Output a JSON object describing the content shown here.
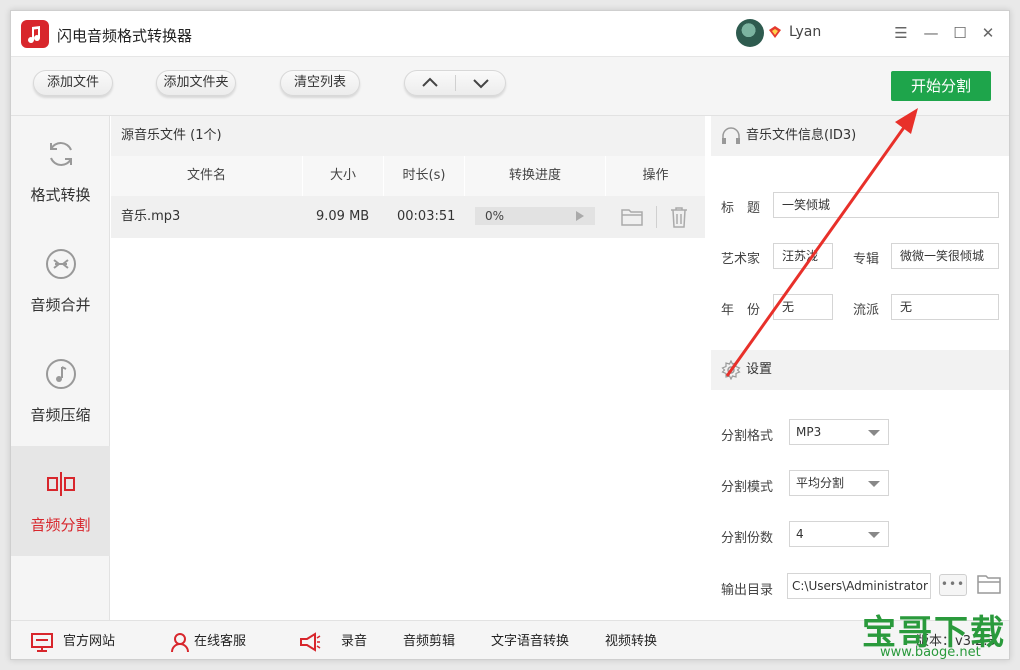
{
  "app": {
    "title": "闪电音频格式转换器",
    "username": "Lyan"
  },
  "window_controls": {
    "menu": "☰",
    "minimize": "—",
    "maximize": "☐",
    "close": "✕"
  },
  "toolbar": {
    "add_file": "添加文件",
    "add_folder": "添加文件夹",
    "clear_list": "清空列表",
    "move_up": "︿",
    "move_down": "﹀",
    "start": "开始分割"
  },
  "nav": {
    "items": [
      {
        "label": "格式转换",
        "icon": "refresh-icon"
      },
      {
        "label": "音频合并",
        "icon": "merge-icon"
      },
      {
        "label": "音频压缩",
        "icon": "music-note-icon"
      },
      {
        "label": "音频分割",
        "icon": "split-icon",
        "active": true
      }
    ]
  },
  "files": {
    "header": "源音乐文件 (1个)",
    "columns": [
      "文件名",
      "大小",
      "时长(s)",
      "转换进度",
      "操作"
    ],
    "rows": [
      {
        "name": "音乐.mp3",
        "size": "9.09 MB",
        "duration": "00:03:51",
        "progress_text": "0%",
        "progress": 0
      }
    ]
  },
  "info": {
    "header": "音乐文件信息(ID3)",
    "title_label": "标　题",
    "title_value": "一笑倾城",
    "artist_label": "艺术家",
    "artist_value": "汪苏泷",
    "album_label": "专辑",
    "album_value": "微微一笑很倾城",
    "year_label": "年　份",
    "year_value": "无",
    "genre_label": "流派",
    "genre_value": "无"
  },
  "settings": {
    "header": "设置",
    "format_label": "分割格式",
    "format_value": "MP3",
    "mode_label": "分割模式",
    "mode_value": "平均分割",
    "count_label": "分割份数",
    "count_value": "4",
    "output_label": "输出目录",
    "output_value": "C:\\Users\\Administrator",
    "more": "•••"
  },
  "bottom": {
    "website": "官方网站",
    "support": "在线客服",
    "record": "录音",
    "audio_cut": "音频剪辑",
    "tts": "文字语音转换",
    "video_convert": "视频转换",
    "version": "版本：v3.2.3"
  },
  "watermark": {
    "brand": "宝哥下载",
    "url": "www.baoge.net"
  },
  "colors": {
    "accent_green": "#1ea54b",
    "accent_red": "#d8262c",
    "annotation_red": "#e8302a"
  }
}
